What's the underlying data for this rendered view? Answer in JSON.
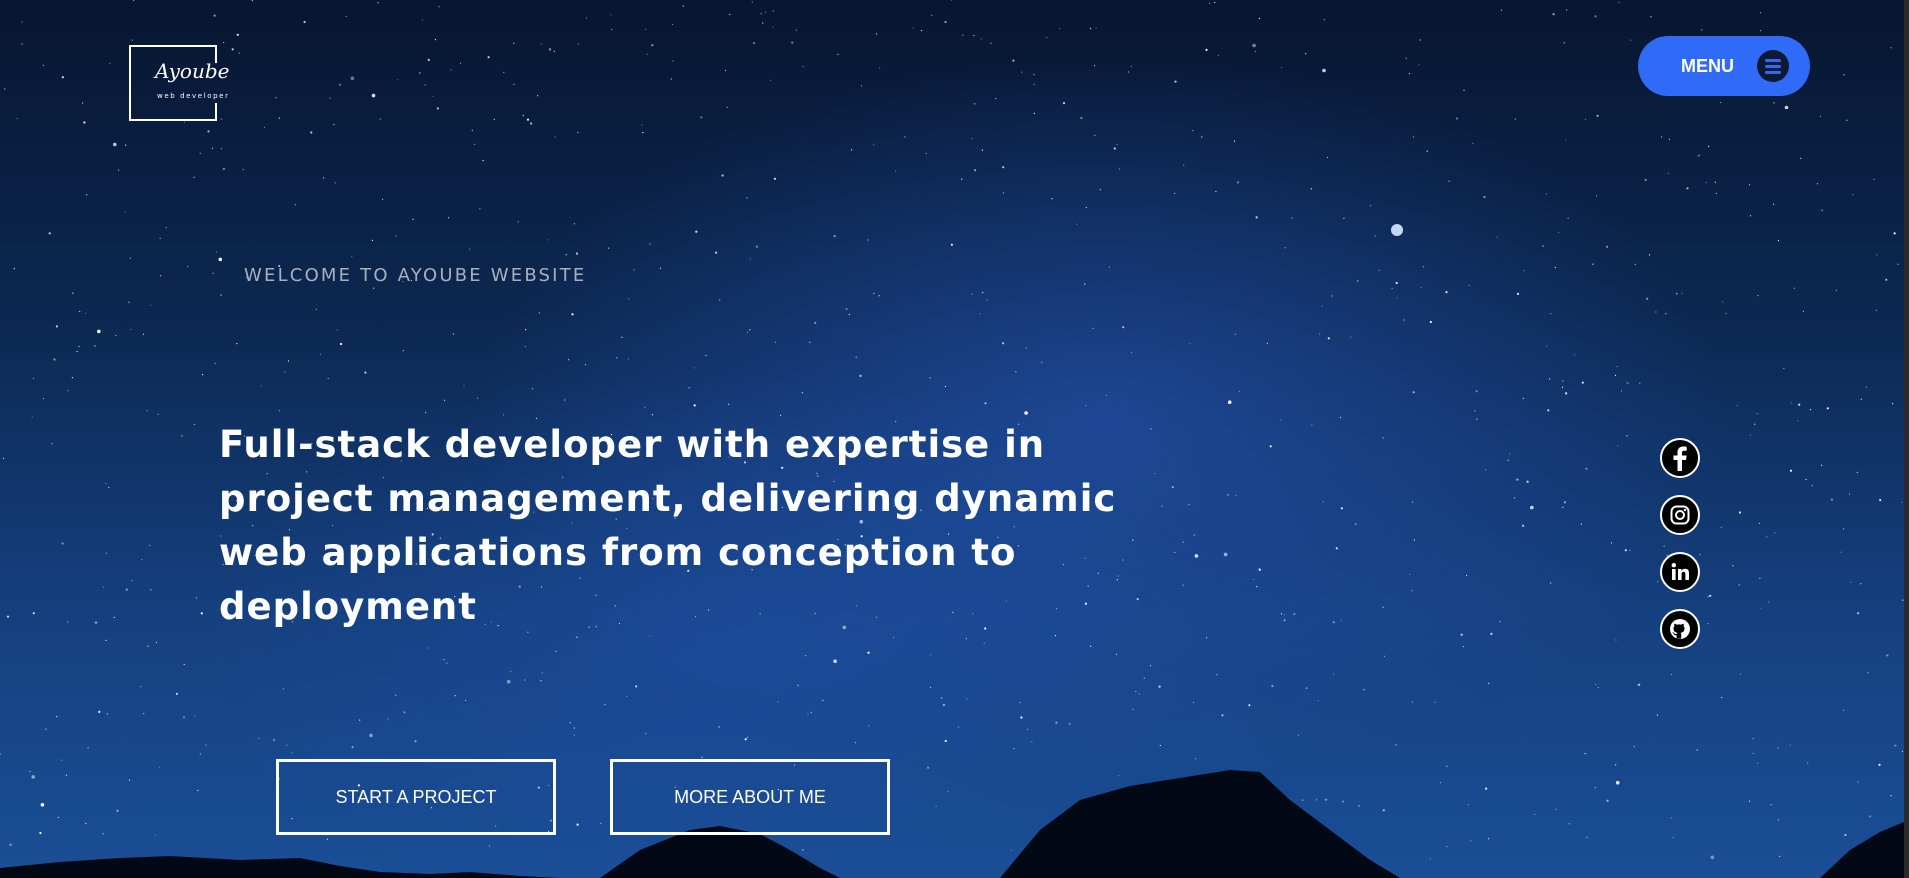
{
  "logo": {
    "name": "Ayoube",
    "subtitle": "web developer"
  },
  "menu": {
    "label": "MENU",
    "icon": "hamburger-icon"
  },
  "hero": {
    "welcome": "WELCOME TO AYOUBE WEBSITE",
    "headline": "Full-stack developer with expertise in project management, delivering dynamic web applications from conception to deployment"
  },
  "buttons": {
    "start_project": "START A PROJECT",
    "more_about": "MORE ABOUT ME"
  },
  "social": [
    {
      "icon": "facebook-icon"
    },
    {
      "icon": "instagram-icon"
    },
    {
      "icon": "linkedin-icon"
    },
    {
      "icon": "github-icon"
    }
  ],
  "colors": {
    "accent": "#2f6bf6",
    "sky_top": "#071631",
    "sky_bottom": "#1a4e96"
  }
}
